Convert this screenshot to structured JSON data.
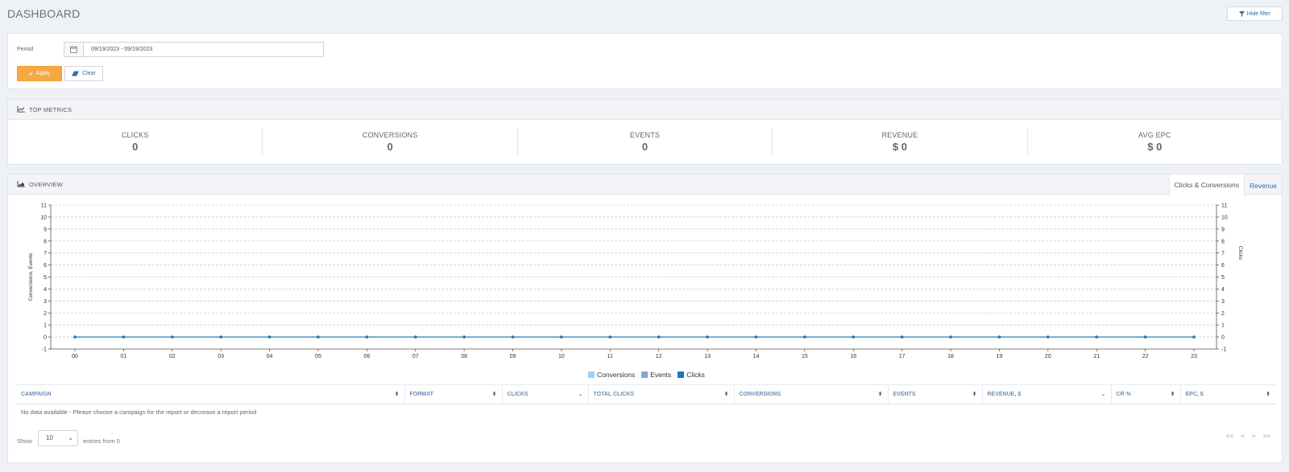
{
  "page": {
    "title": "DASHBOARD",
    "hide_filter_label": "Hide filter"
  },
  "filter": {
    "period_label": "Period",
    "period_value": "09/19/2023 - 09/19/2023",
    "apply_label": "Apply",
    "clear_label": "Clear"
  },
  "top_metrics": {
    "title": "TOP METRICS",
    "items": [
      {
        "label": "CLICKS",
        "value": "0"
      },
      {
        "label": "CONVERSIONS",
        "value": "0"
      },
      {
        "label": "EVENTS",
        "value": "0"
      },
      {
        "label": "REVENUE",
        "value": "$ 0"
      },
      {
        "label": "AVG EPC",
        "value": "$ 0"
      }
    ]
  },
  "overview": {
    "title": "OVERVIEW",
    "tabs": [
      {
        "label": "Clicks & Conversions",
        "active": true
      },
      {
        "label": "Revenue",
        "active": false
      }
    ]
  },
  "chart_data": {
    "type": "line",
    "x": [
      "00",
      "01",
      "02",
      "03",
      "04",
      "05",
      "06",
      "07",
      "08",
      "09",
      "10",
      "11",
      "12",
      "13",
      "14",
      "15",
      "16",
      "17",
      "18",
      "19",
      "20",
      "21",
      "22",
      "23"
    ],
    "series": [
      {
        "name": "Conversions",
        "color": "#9fd0f2",
        "axis": "left",
        "values": [
          0,
          0,
          0,
          0,
          0,
          0,
          0,
          0,
          0,
          0,
          0,
          0,
          0,
          0,
          0,
          0,
          0,
          0,
          0,
          0,
          0,
          0,
          0,
          0
        ]
      },
      {
        "name": "Events",
        "color": "#7eaad6",
        "axis": "left",
        "values": [
          0,
          0,
          0,
          0,
          0,
          0,
          0,
          0,
          0,
          0,
          0,
          0,
          0,
          0,
          0,
          0,
          0,
          0,
          0,
          0,
          0,
          0,
          0,
          0
        ]
      },
      {
        "name": "Clicks",
        "color": "#1f78b4",
        "axis": "right",
        "values": [
          0,
          0,
          0,
          0,
          0,
          0,
          0,
          0,
          0,
          0,
          0,
          0,
          0,
          0,
          0,
          0,
          0,
          0,
          0,
          0,
          0,
          0,
          0,
          0
        ]
      }
    ],
    "ylabel": "Conversions, Events",
    "y2label": "Clicks",
    "ylim": [
      -1,
      11
    ],
    "y_ticks": [
      -1,
      0,
      1,
      2,
      3,
      4,
      5,
      6,
      7,
      8,
      9,
      10,
      11
    ],
    "grid": true,
    "legend_position": "bottom"
  },
  "table": {
    "columns": [
      {
        "label": "CAMPAIGN",
        "sort": "⬍"
      },
      {
        "label": "FORMAT",
        "sort": "⬍"
      },
      {
        "label": "CLICKS",
        "sort": "⌄"
      },
      {
        "label": "TOTAL CLICKS",
        "sort": "⬍"
      },
      {
        "label": "CONVERSIONS",
        "sort": "⬍"
      },
      {
        "label": "EVENTS",
        "sort": "⬍"
      },
      {
        "label": "REVENUE, $",
        "sort": "⌄"
      },
      {
        "label": "CR %",
        "sort": "⬍"
      },
      {
        "label": "EPC, $",
        "sort": "⬍"
      }
    ],
    "empty_message": "No data available - Please choose a campaign for the report or decrease a report period"
  },
  "pagination": {
    "show_label": "Show",
    "page_size": "10",
    "entries_label": "entries from 0",
    "first": "<<",
    "prev": "<",
    "next": ">",
    "last": ">>"
  }
}
